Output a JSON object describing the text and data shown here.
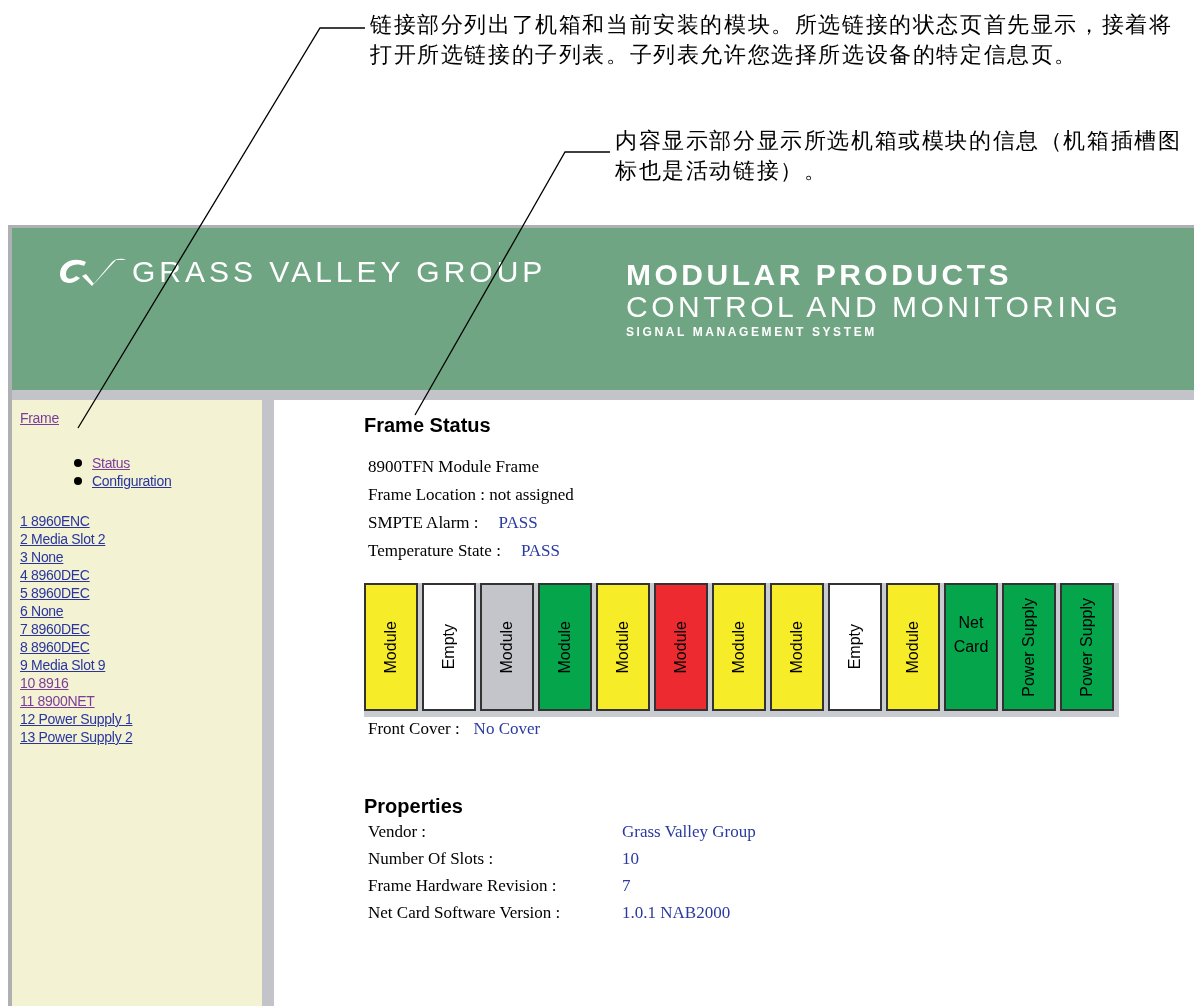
{
  "callouts": [
    "链接部分列出了机箱和当前安装的模块。所选链接的状态页首先显示，接着将打开所选链接的子列表。子列表允许您选择所选设备的特定信息页。",
    "内容显示部分显示所选机箱或模块的信息（机箱插槽图标也是活动链接）。"
  ],
  "header": {
    "logo_text": "GRASS VALLEY GROUP",
    "title_1": "MODULAR PRODUCTS",
    "title_2": "CONTROL AND MONITORING",
    "subtitle": "SIGNAL MANAGEMENT SYSTEM"
  },
  "sidebar": {
    "frame_link": {
      "label": "Frame",
      "visited": true
    },
    "sub_links": [
      {
        "label": "Status",
        "visited": true
      },
      {
        "label": "Configuration",
        "visited": false
      }
    ],
    "slot_links": [
      {
        "label": "1 8960ENC",
        "visited": false
      },
      {
        "label": "2 Media Slot 2",
        "visited": false
      },
      {
        "label": "3 None",
        "visited": false
      },
      {
        "label": "4 8960DEC",
        "visited": false
      },
      {
        "label": "5 8960DEC",
        "visited": false
      },
      {
        "label": "6 None",
        "visited": false
      },
      {
        "label": "7 8960DEC",
        "visited": false
      },
      {
        "label": "8 8960DEC",
        "visited": false
      },
      {
        "label": "9 Media Slot 9",
        "visited": false
      },
      {
        "label": "10 8916",
        "visited": true
      },
      {
        "label": "11 8900NET",
        "visited": true
      },
      {
        "label": "12 Power Supply 1",
        "visited": false
      },
      {
        "label": "13 Power Supply 2",
        "visited": false
      }
    ]
  },
  "content": {
    "title": "Frame Status",
    "frame_name": "8900TFN Module Frame",
    "status_rows": [
      {
        "label": "Frame Location : not assigned"
      },
      {
        "label": "SMPTE Alarm :",
        "value": "PASS"
      },
      {
        "label": "Temperature State :",
        "value": "PASS"
      }
    ],
    "slots": [
      {
        "label": "Module",
        "color": "#f7ec28",
        "kind": "vertical"
      },
      {
        "label": "Empty",
        "color": "#ffffff",
        "kind": "vertical"
      },
      {
        "label": "Module",
        "color": "#c3c5ca",
        "kind": "vertical"
      },
      {
        "label": "Module",
        "color": "#05a64b",
        "kind": "vertical"
      },
      {
        "label": "Module",
        "color": "#f7ec28",
        "kind": "vertical"
      },
      {
        "label": "Module",
        "color": "#ec2a30",
        "kind": "vertical"
      },
      {
        "label": "Module",
        "color": "#f7ec28",
        "kind": "vertical"
      },
      {
        "label": "Module",
        "color": "#f7ec28",
        "kind": "vertical"
      },
      {
        "label": "Empty",
        "color": "#ffffff",
        "kind": "vertical"
      },
      {
        "label": "Module",
        "color": "#f7ec28",
        "kind": "vertical"
      },
      {
        "label": "Net Card",
        "color": "#05a64b",
        "kind": "horizontal"
      },
      {
        "label": "Power Supply",
        "color": "#05a64b",
        "kind": "vertical"
      },
      {
        "label": "Power Supply",
        "color": "#05a64b",
        "kind": "vertical"
      }
    ],
    "front_cover": {
      "label": "Front Cover :",
      "value": "No Cover"
    },
    "properties_title": "Properties",
    "properties": [
      {
        "label": "Vendor :",
        "value": "Grass Valley Group"
      },
      {
        "label": "Number Of Slots :",
        "value": "10"
      },
      {
        "label": "Frame Hardware Revision :",
        "value": "7"
      },
      {
        "label": "Net Card Software Version :",
        "value": "1.0.1 NAB2000"
      }
    ]
  }
}
